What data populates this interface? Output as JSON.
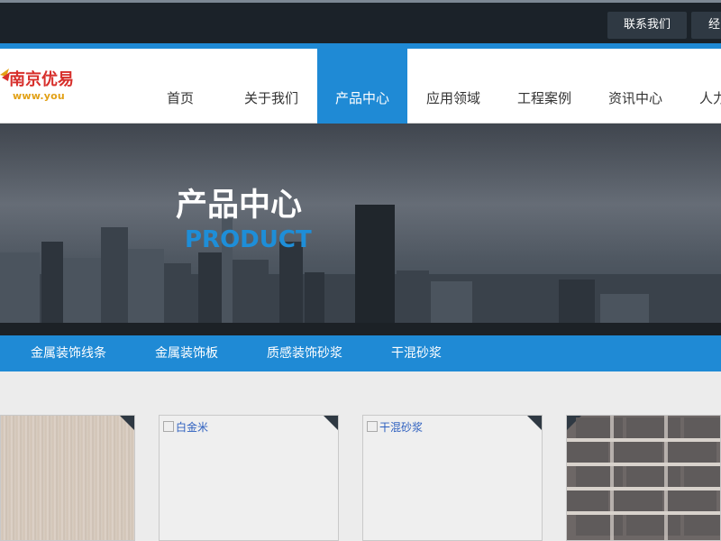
{
  "top_bar": {
    "contact_label": "联系我们",
    "partial_label": "经"
  },
  "logo": {
    "title": "南京优易",
    "url_text": "www.you"
  },
  "nav": {
    "items": [
      {
        "label": "首页"
      },
      {
        "label": "关于我们"
      },
      {
        "label": "产品中心"
      },
      {
        "label": "应用领域"
      },
      {
        "label": "工程案例"
      },
      {
        "label": "资讯中心"
      },
      {
        "label": "人力"
      }
    ],
    "active_index": 2
  },
  "banner": {
    "title": "产品中心",
    "subtitle": "PRODUCT"
  },
  "subnav": {
    "items": [
      {
        "label": "金属装饰线条"
      },
      {
        "label": "金属装饰板"
      },
      {
        "label": "质感装饰砂浆"
      },
      {
        "label": "干混砂浆"
      }
    ]
  },
  "products": [
    {
      "kind": "wood-texture"
    },
    {
      "alt": "白金米"
    },
    {
      "alt": "干混砂浆"
    },
    {
      "kind": "brick-texture"
    }
  ],
  "colors": {
    "accent_blue": "#1f8ad5",
    "top_bar": "#1b2229",
    "brand_red": "#d72f2b",
    "brand_gold": "#e2a117"
  }
}
